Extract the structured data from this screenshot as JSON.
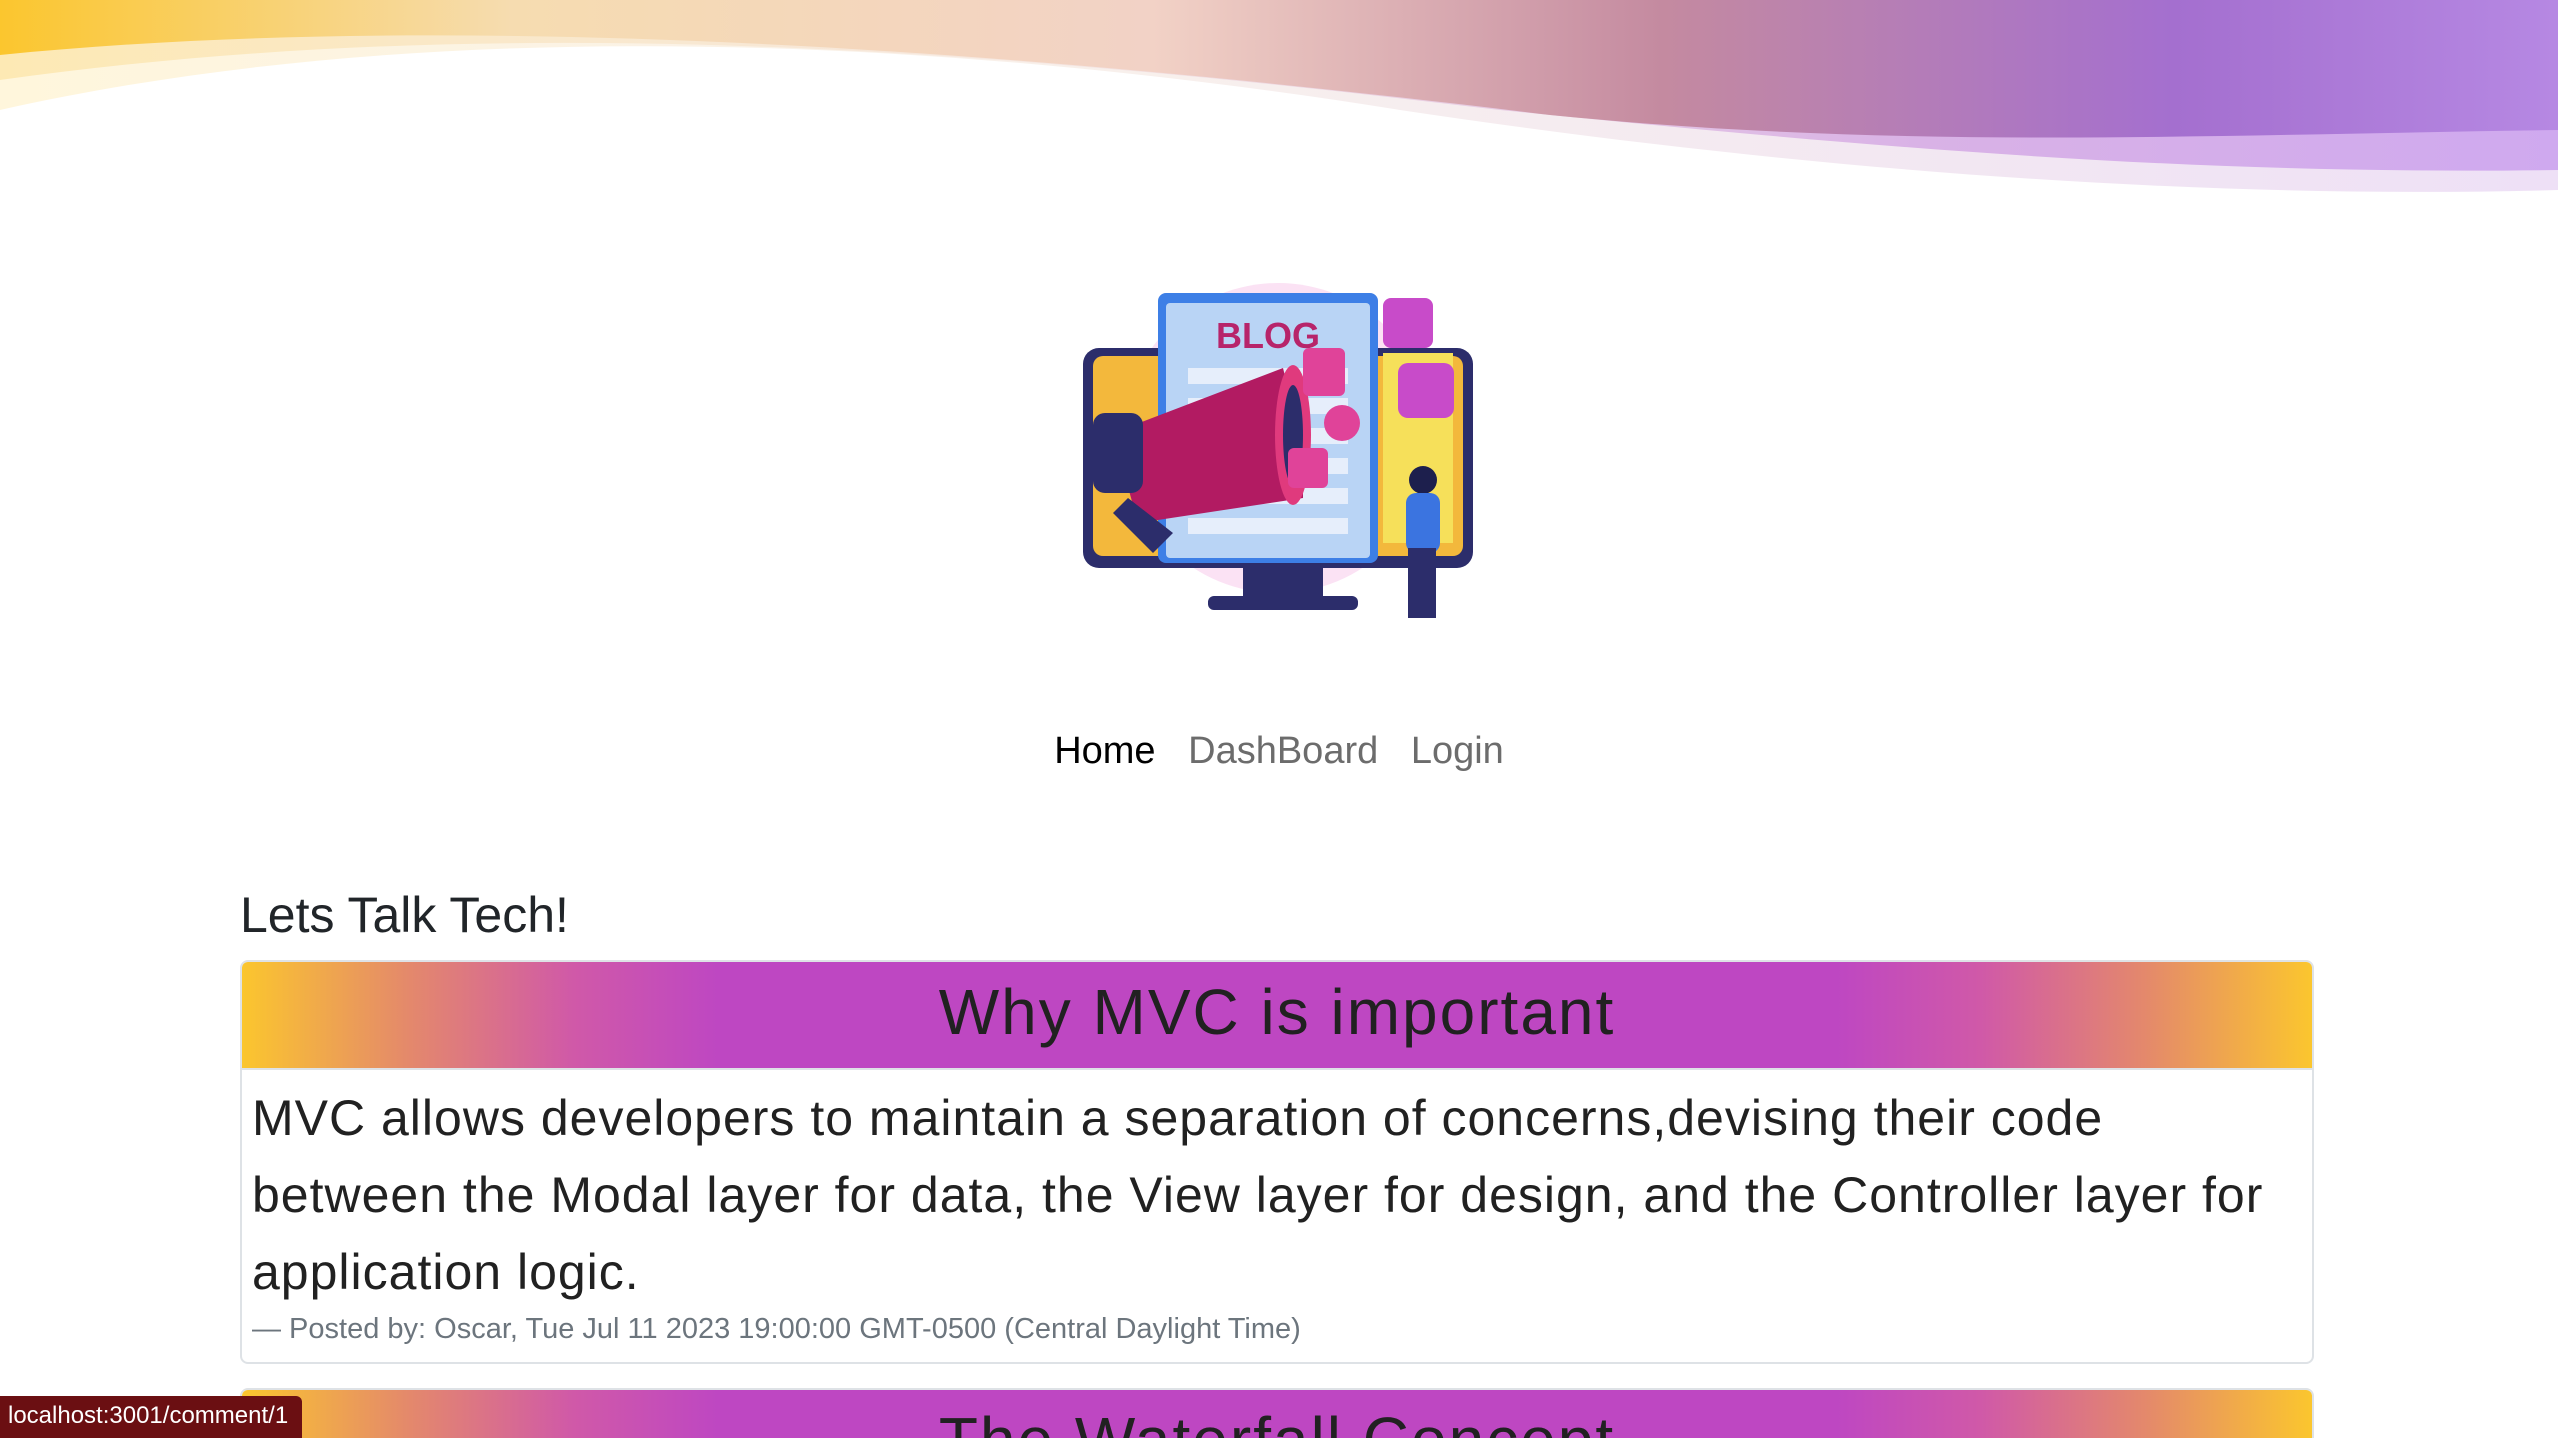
{
  "nav": {
    "items": [
      {
        "label": "Home",
        "active": true
      },
      {
        "label": "DashBoard",
        "active": false
      },
      {
        "label": "Login",
        "active": false
      }
    ]
  },
  "logo": {
    "text": "BLOG"
  },
  "main": {
    "title": "Lets Talk Tech!",
    "posts": [
      {
        "title": "Why MVC is important",
        "body": "MVC allows developers to maintain a separation of concerns,devising their code between the Modal layer for data, the View layer for design, and the Controller layer for application logic.",
        "meta": "— Posted by: Oscar, Tue Jul 11 2023 19:00:00 GMT-0500 (Central Daylight Time)"
      },
      {
        "title": "The Waterfall Concept"
      }
    ]
  },
  "status_bar": {
    "url": "localhost:3001/comment/1"
  },
  "colors": {
    "header_gradient_edge": "#fbc62e",
    "header_gradient_center": "#be47c2",
    "status_bg": "#6b0f12"
  }
}
